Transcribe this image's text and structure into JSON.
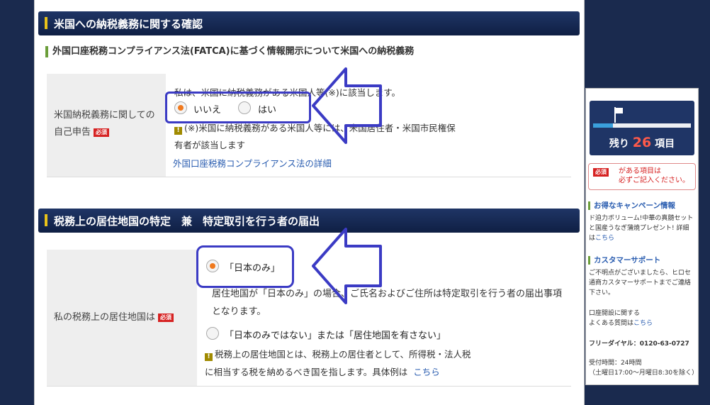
{
  "section1": {
    "title": "米国への納税義務に関する確認",
    "subtitle": "外国口座税務コンプライアンス法(FATCA)に基づく情報開示について米国への納税義務",
    "label_line1": "米国納税義務に関しての",
    "label_line2": "自己申告",
    "required": "必須",
    "statement": "私は、米国に納税義務がある米国人等(※)に該当します。",
    "option_no": "いいえ",
    "option_yes": "はい",
    "note_line1": "(※)米国に納税義務がある米国人等には、米国居住者・米国市民権保",
    "note_line2": "有者が該当します",
    "link": "外国口座税務コンプライアンス法の詳細"
  },
  "section2": {
    "title": "税務上の居住地国の特定　兼　特定取引を行う者の届出",
    "label": "私の税務上の居住地国は",
    "required": "必須",
    "option_japan": "「日本のみ」",
    "japan_desc_line1": "居住地国が「日本のみ」の場合、ご氏名およびご住所は特定取引を行う者の届出事項",
    "japan_desc_line2": "となります。",
    "option_not_japan": "「日本のみではない」または「居住地国を有さない」",
    "note_line1": "税務上の居住地国とは、税務上の居住者として、所得税・法人税",
    "note_line2": "に相当する税を納めるべき国を指します。具体例は",
    "note_link": "こちら"
  },
  "sidebar": {
    "remaining_prefix": "残り",
    "remaining_count": "26",
    "remaining_suffix": "項目",
    "progress": 0.2,
    "required_badge": "必須",
    "required_note_line1": "がある項目は",
    "required_note_line2": "必ずご記入ください。",
    "campaign_title": "お得なキャンペーン情報",
    "campaign_line1": "ド迫力ボリューム!中華の真髄セット",
    "campaign_line2": "と国産うなぎ蒲焼プレゼント! 詳細",
    "campaign_line3": "は",
    "campaign_link": "こちら",
    "support_title": "カスタマーサポート",
    "support_line1": "ご不明点がございましたら、ヒロセ",
    "support_line2": "通商カスタマーサポートまでご連絡",
    "support_line3": "下さい。",
    "faq_line1": "口座開設に関する",
    "faq_line2": "よくある質問は",
    "faq_link": "こちら",
    "freedial": "フリーダイヤル：0120-63-0727",
    "hours_line1": "受付時間：24時間",
    "hours_line2": "（土曜日17:00〜月曜日8:30を除く）"
  }
}
